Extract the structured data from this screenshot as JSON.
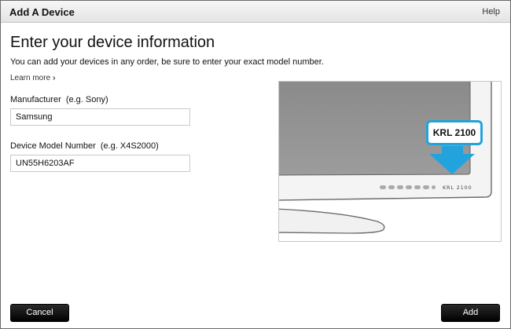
{
  "window": {
    "title": "Add A Device",
    "help_label": "Help"
  },
  "main": {
    "heading": "Enter your device information",
    "subtext": "You can add your devices in any order, be sure to enter your exact model number.",
    "learn_more": "Learn more",
    "learn_more_icon": "chevron-right-icon"
  },
  "form": {
    "manufacturer": {
      "label": "Manufacturer",
      "example": "(e.g. Sony)",
      "value": "Samsung"
    },
    "model": {
      "label": "Device Model Number",
      "example": "(e.g. X4S2000)",
      "value": "UN55H6203AF"
    }
  },
  "illustration": {
    "callout_text": "KRL 2100",
    "tv_model_label": "KRL 2100",
    "accent_color": "#22a3dd"
  },
  "footer": {
    "cancel_label": "Cancel",
    "add_label": "Add"
  }
}
